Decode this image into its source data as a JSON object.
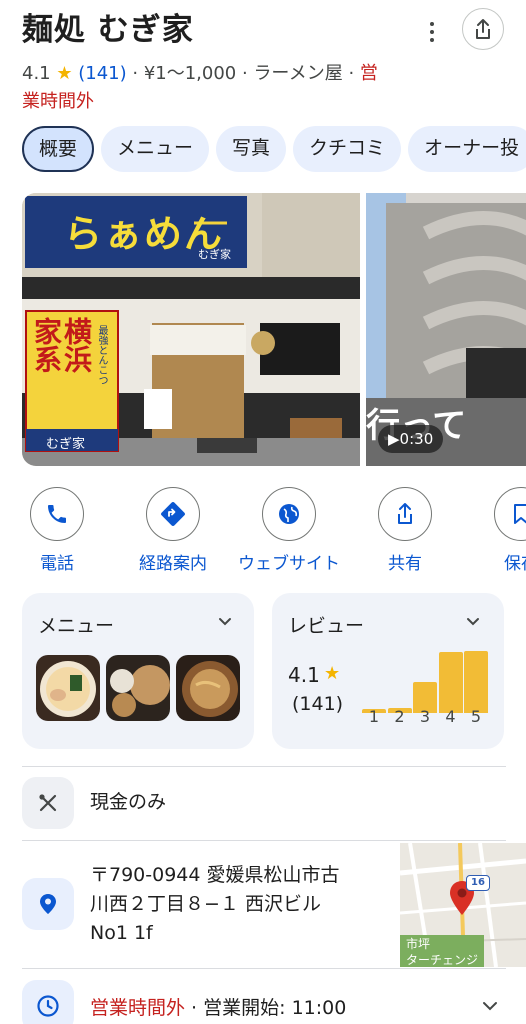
{
  "place": {
    "name": "麺処 むぎ家",
    "rating": "4.1",
    "star": "★",
    "review_count": "(141)",
    "price": "¥1～1,000",
    "category": "ラーメン屋",
    "status_line1": "営",
    "status_line2": "業時間外",
    "separator": " · "
  },
  "tabs": [
    {
      "label": "概要"
    },
    {
      "label": "メニュー"
    },
    {
      "label": "写真"
    },
    {
      "label": "クチコミ"
    },
    {
      "label": "オーナー投"
    }
  ],
  "photos": {
    "sign_main": "らぁめん",
    "sign_small": "むぎ家",
    "banner_line1": "横浜",
    "banner_line2": "家系",
    "banner_small": "最強とんこつ",
    "banner_bottom": "むぎ家",
    "video_duration": "0:30",
    "video_overlay_text": "行って"
  },
  "actions": [
    {
      "label": "電話",
      "icon": "phone-icon"
    },
    {
      "label": "経路案内",
      "icon": "directions-icon"
    },
    {
      "label": "ウェブサイト",
      "icon": "globe-icon"
    },
    {
      "label": "共有",
      "icon": "share-icon"
    },
    {
      "label": "保存",
      "icon": "bookmark-icon"
    }
  ],
  "menu_card": {
    "title": "メニュー"
  },
  "review_card": {
    "title": "レビュー",
    "rating": "4.1",
    "star": "★",
    "count": "(141)"
  },
  "chart_data": {
    "type": "bar",
    "categories": [
      "1",
      "2",
      "3",
      "4",
      "5"
    ],
    "values": [
      0.06,
      0.08,
      0.5,
      0.98,
      1.0
    ],
    "ylim": [
      0,
      1
    ]
  },
  "payment": {
    "label": "現金のみ"
  },
  "address": {
    "line1": "〒790-0944 愛媛県松山市古",
    "line2": "川西２丁目８−１ 西沢ビル",
    "line3": "No1 1f"
  },
  "map": {
    "label": "市坪",
    "label2": "ターチェンジ",
    "route": "16"
  },
  "hours": {
    "status": "営業時間外",
    "separator": " · ",
    "opening": "営業開始: 11:00"
  },
  "colors": {
    "accent": "#0b57d0",
    "closed": "#c5221f",
    "star": "#f4b400",
    "bar": "#f2bc36"
  }
}
